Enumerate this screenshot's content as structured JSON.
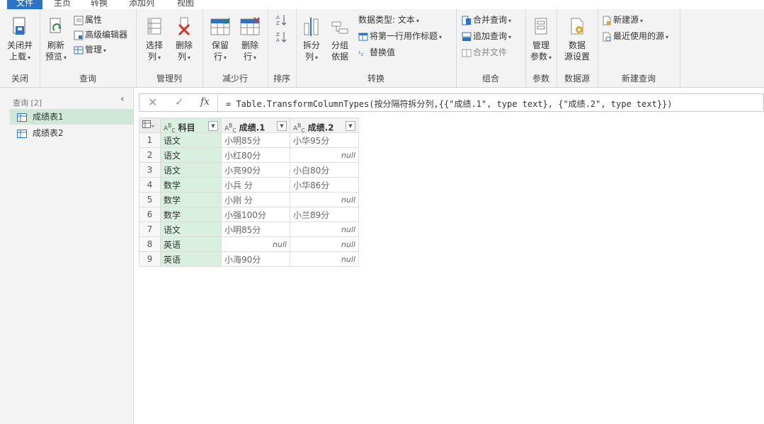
{
  "menu": {
    "file": "文件",
    "home": "主页",
    "transform": "转换",
    "add_column": "添加列",
    "view": "视图"
  },
  "ribbon": {
    "close": {
      "btn1": "关闭并",
      "btn2": "上载",
      "label": "关闭"
    },
    "query": {
      "refresh1": "刷新",
      "refresh2": "预览",
      "properties": "属性",
      "advanced_editor": "高级编辑器",
      "manage": "管理",
      "label": "查询"
    },
    "manage_cols": {
      "choose1": "选择",
      "choose2": "列",
      "remove1": "删除",
      "remove2": "列",
      "label": "管理列"
    },
    "reduce_rows": {
      "keep1": "保留",
      "keep2": "行",
      "remove1": "删除",
      "remove2": "行",
      "label": "减少行"
    },
    "sort": {
      "label": "排序"
    },
    "transform": {
      "split1": "拆分",
      "split2": "列",
      "group1": "分组",
      "group2": "依据",
      "data_type": "数据类型: 文本",
      "first_row_header": "将第一行用作标题",
      "replace_values": "替换值",
      "label": "转换"
    },
    "combine": {
      "merge_queries": "合并查询",
      "append_queries": "追加查询",
      "combine_files": "合并文件",
      "label": "组合"
    },
    "params": {
      "manage1": "管理",
      "manage2": "参数",
      "label": "参数"
    },
    "datasource": {
      "settings1": "数据",
      "settings2": "源设置",
      "label": "数据源"
    },
    "new_query": {
      "new_source": "新建源",
      "recent_sources": "最近使用的源",
      "label": "新建查询"
    }
  },
  "queries_panel": {
    "title": "查询 [2]",
    "items": [
      {
        "label": "成绩表1",
        "selected": true
      },
      {
        "label": "成绩表2",
        "selected": false
      }
    ]
  },
  "formula_bar": {
    "formula": "= Table.TransformColumnTypes(按分隔符拆分列,{{\"成绩.1\", type text}, {\"成绩.2\", type text}})"
  },
  "table": {
    "headers": [
      "科目",
      "成绩.1",
      "成绩.2"
    ],
    "type_icon": "Aᴮᴄ",
    "rows": [
      {
        "n": "1",
        "c1": "语文",
        "c2": "小明85分",
        "c3": "小华95分"
      },
      {
        "n": "2",
        "c1": "语文",
        "c2": "小红80分",
        "c3": "null"
      },
      {
        "n": "3",
        "c1": "语文",
        "c2": "小亮90分",
        "c3": "小白80分"
      },
      {
        "n": "4",
        "c1": "数学",
        "c2": "小兵 分",
        "c3": "小华86分"
      },
      {
        "n": "5",
        "c1": "数学",
        "c2": "小刚 分",
        "c3": "null"
      },
      {
        "n": "6",
        "c1": "数学",
        "c2": "小强100分",
        "c3": "小兰89分"
      },
      {
        "n": "7",
        "c1": "语文",
        "c2": "小明85分",
        "c3": "null"
      },
      {
        "n": "8",
        "c1": "英语",
        "c2": "null",
        "c3": "null"
      },
      {
        "n": "9",
        "c1": "英语",
        "c2": "小海90分",
        "c3": "null"
      }
    ]
  },
  "colors": {
    "accent": "#2b73c4",
    "selected_column": "#d9efe0",
    "ribbon_bg": "#f3f3f3"
  }
}
